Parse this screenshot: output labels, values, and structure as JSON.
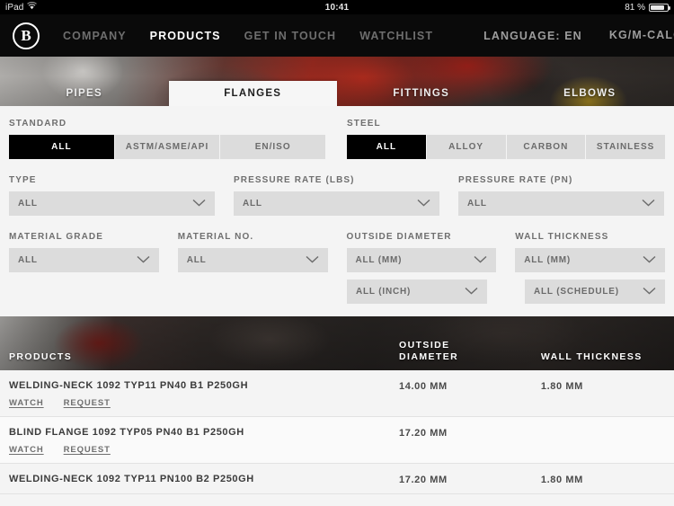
{
  "statusbar": {
    "device": "iPad",
    "wifi_icon": "wifi-icon",
    "time": "10:41",
    "battery_percent": "81 %",
    "battery_icon": "battery-icon"
  },
  "topnav": {
    "logo_letter": "B",
    "items": [
      {
        "label": "COMPANY",
        "active": false
      },
      {
        "label": "PRODUCTS",
        "active": true
      },
      {
        "label": "GET IN TOUCH",
        "active": false
      },
      {
        "label": "WATCHLIST",
        "active": false
      }
    ],
    "language": "LANGUAGE: EN",
    "calculator": "KG/M-CALCULATOR",
    "calculator_icon": "grid-calculator-icon"
  },
  "tabs": [
    {
      "label": "PIPES",
      "active": false
    },
    {
      "label": "FLANGES",
      "active": true
    },
    {
      "label": "FITTINGS",
      "active": false
    },
    {
      "label": "ELBOWS",
      "active": false
    }
  ],
  "filters": {
    "standard": {
      "label": "STANDARD",
      "options": [
        "ALL",
        "ASTM/ASME/API",
        "EN/ISO"
      ],
      "selected": "ALL"
    },
    "steel": {
      "label": "STEEL",
      "options": [
        "ALL",
        "ALLOY",
        "CARBON",
        "STAINLESS"
      ],
      "selected": "ALL"
    },
    "dropdowns_row1": [
      {
        "label": "TYPE",
        "value": "ALL"
      },
      {
        "label": "PRESSURE RATE (LBS)",
        "value": "ALL"
      },
      {
        "label": "PRESSURE RATE (PN)",
        "value": "ALL"
      }
    ],
    "dropdowns_row2": [
      {
        "label": "MATERIAL GRADE",
        "value": "ALL"
      },
      {
        "label": "MATERIAL NO.",
        "value": "ALL"
      },
      {
        "label": "OUTSIDE DIAMETER",
        "value": "ALL (MM)"
      },
      {
        "label": "WALL THICKNESS",
        "value": "ALL (MM)"
      }
    ],
    "dropdowns_row3": [
      {
        "value": "ALL (INCH)"
      },
      {
        "value": "ALL (SCHEDULE)"
      }
    ]
  },
  "results": {
    "headers": {
      "products": "PRODUCTS",
      "outside_diameter_line1": "OUTSIDE",
      "outside_diameter_line2": "DIAMETER",
      "wall_thickness": "WALL THICKNESS"
    },
    "link_watch": "WATCH",
    "link_request": "REQUEST",
    "rows": [
      {
        "name": "WELDING-NECK 1092 TYP11 PN40 B1 P250GH",
        "outside_diameter": "14.00 MM",
        "wall_thickness": "1.80 MM"
      },
      {
        "name": "BLIND FLANGE 1092 TYP05 PN40 B1 P250GH",
        "outside_diameter": "17.20 MM",
        "wall_thickness": ""
      },
      {
        "name": "WELDING-NECK 1092 TYP11 PN100 B2 P250GH",
        "outside_diameter": "17.20 MM",
        "wall_thickness": "1.80 MM"
      }
    ]
  },
  "colors": {
    "nav_bg": "#0a0a0a",
    "panel_bg": "#f4f4f4",
    "control_bg": "#dcdcdc",
    "selected_bg": "#000000",
    "text_muted": "#6b6b6b"
  }
}
